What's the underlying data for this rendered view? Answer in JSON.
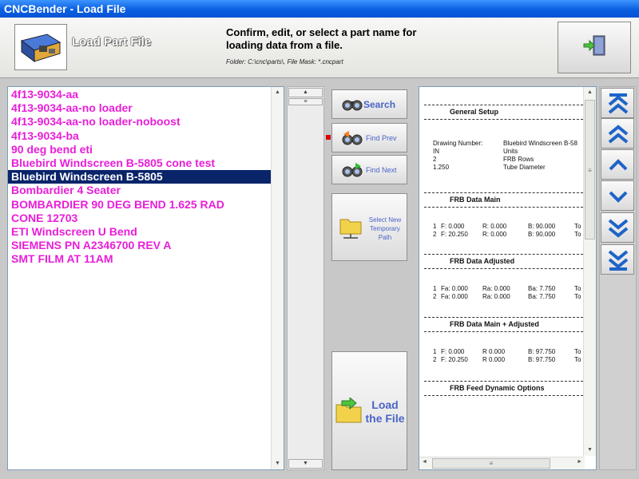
{
  "window": {
    "title": "CNCBender - Load File"
  },
  "header": {
    "title": "Load Part File",
    "instructions": "Confirm, edit, or select a part name for loading data from a file.",
    "folder_info": "Folder: C:\\cnc\\parts\\, File Mask: *.cncpart"
  },
  "files": [
    "4f13-9034-aa",
    "4f13-9034-aa-no loader",
    "4f13-9034-aa-no loader-noboost",
    "4f13-9034-ba",
    "90 deg bend eti",
    "Bluebird Windscreen B-5805 cone test",
    "Bluebird Windscreen B-5805",
    "Bombardier 4 Seater",
    "BOMBARDIER 90 DEG BEND 1.625 RAD",
    "CONE 12703",
    "ETI Windscreen U Bend",
    "SIEMENS PN A2346700 REV A",
    "SMT FILM AT 11AM"
  ],
  "selected_index": 6,
  "tools": {
    "search": "Search",
    "find_prev": "Find Prev",
    "find_next": "Find Next",
    "temp_path_1": "Select New",
    "temp_path_2": "Temporary",
    "temp_path_3": "Path",
    "load_1": "Load",
    "load_2": "the File"
  },
  "details": {
    "general": {
      "title": "General Setup",
      "rows": [
        [
          "Drawing Number:",
          "Bluebird Windscreen B-58"
        ],
        [
          "IN",
          "Units"
        ],
        [
          "2",
          "FRB Rows"
        ],
        [
          "1.250",
          "Tube Diameter"
        ]
      ]
    },
    "frb_main": {
      "title": "FRB Data Main",
      "rows": [
        [
          "1",
          "F: 0.000",
          "R: 0.000",
          "B: 90.000",
          "To"
        ],
        [
          "2",
          "F: 20.250",
          "R: 0.000",
          "B: 90.000",
          "To"
        ]
      ]
    },
    "frb_adjusted": {
      "title": "FRB Data Adjusted",
      "rows": [
        [
          "1",
          "Fa: 0.000",
          "Ra: 0.000",
          "Ba: 7.750",
          "To"
        ],
        [
          "2",
          "Fa: 0.000",
          "Ra: 0.000",
          "Ba: 7.750",
          "To"
        ]
      ]
    },
    "frb_main_adjusted": {
      "title": "FRB Data Main + Adjusted",
      "rows": [
        [
          "1",
          "F: 0.000",
          "R 0.000",
          "B: 97.750",
          "To"
        ],
        [
          "2",
          "F: 20.250",
          "R 0.000",
          "B: 97.750",
          "To"
        ]
      ]
    },
    "feed": {
      "title": "FRB Feed Dynamic Options"
    }
  },
  "scroll_glyphs": {
    "up": "▲",
    "down": "▼",
    "left": "◄",
    "right": "►",
    "grip": "≡"
  },
  "colors": {
    "title_bar": "#0a5fe0",
    "file_text": "#e81ed8",
    "selection": "#0a246a",
    "nav_arrow": "#1e64c8"
  }
}
